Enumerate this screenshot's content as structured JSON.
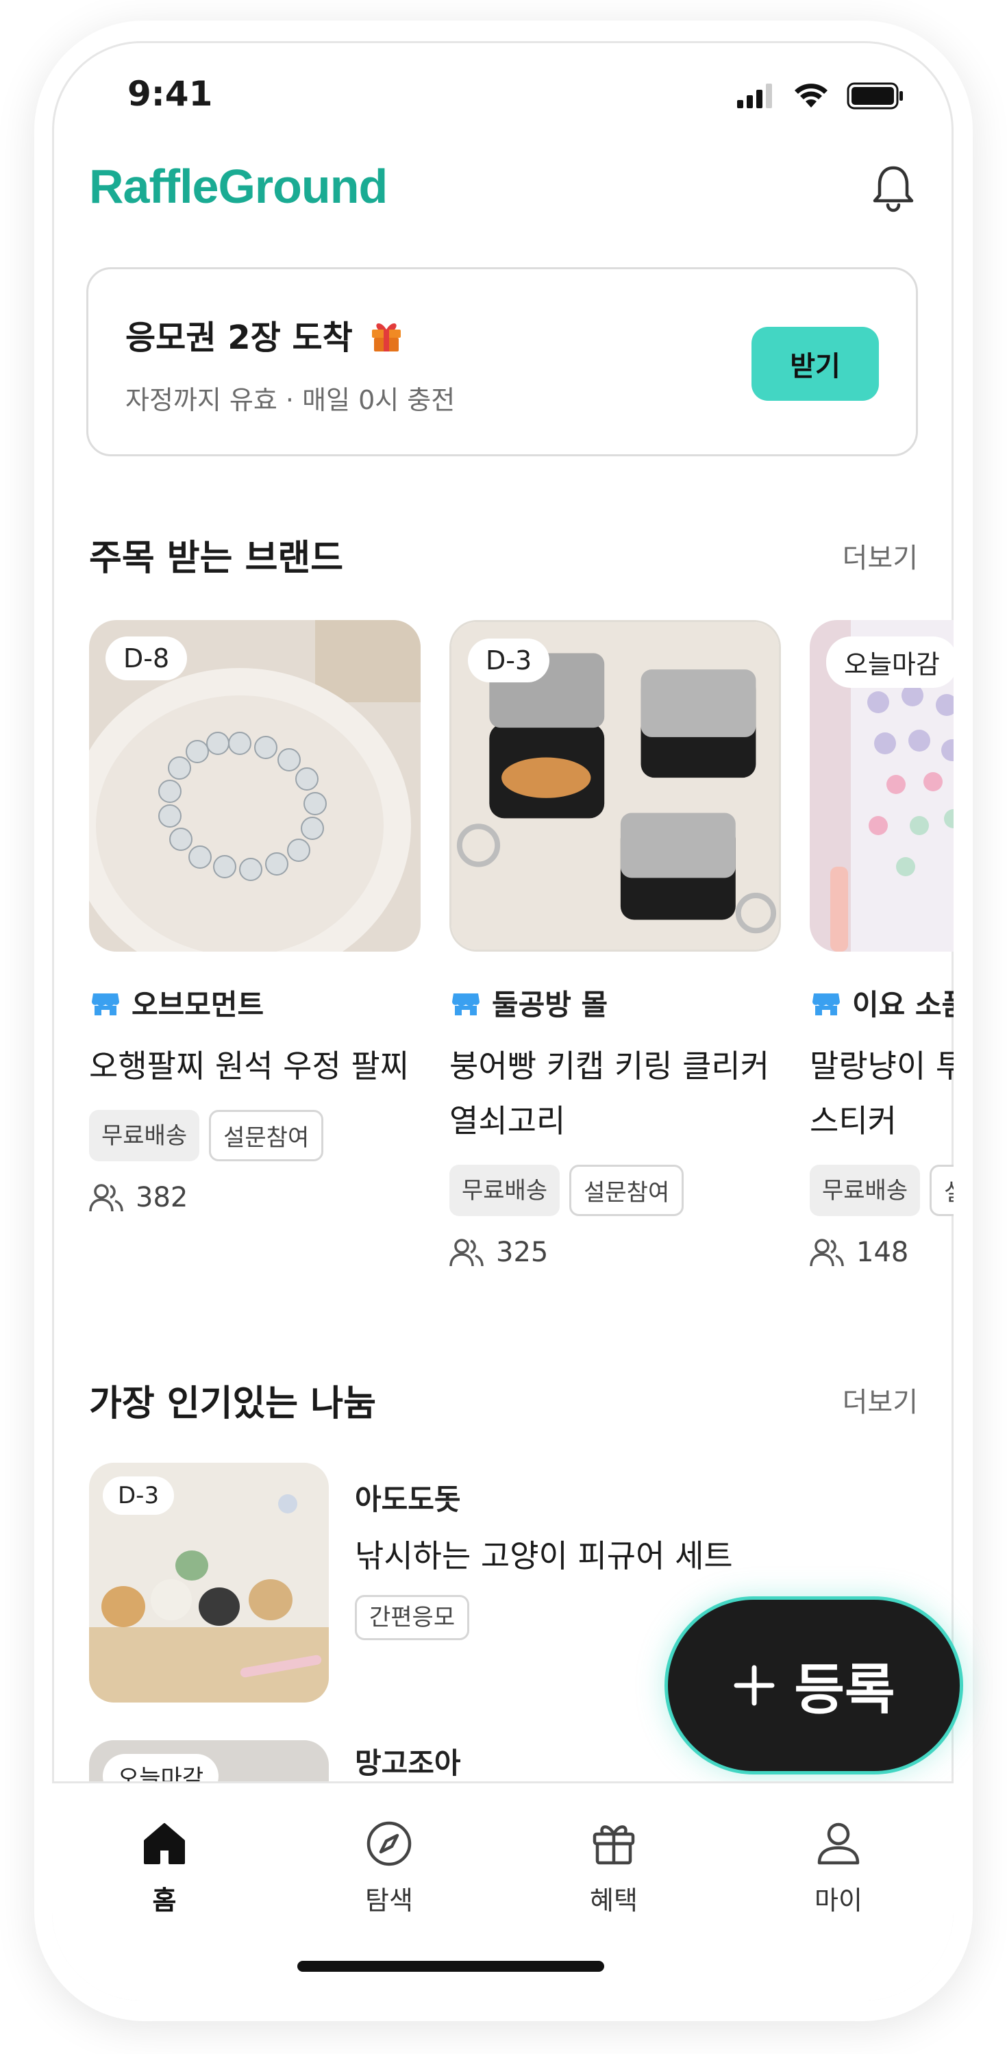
{
  "status_bar": {
    "time": "9:41"
  },
  "header": {
    "app_name": "RaffleGround"
  },
  "ticket_card": {
    "title": "응모권 2장 도착",
    "subtitle": "자정까지 유효 · 매일 0시 충전",
    "button_label": "받기"
  },
  "featured": {
    "title": "주목 받는 브랜드",
    "more_label": "더보기",
    "items": [
      {
        "badge": "D-8",
        "brand": "오브모먼트",
        "title": "오행팔찌 원석 우정 팔찌",
        "tags": [
          "무료배송",
          "설문참여"
        ],
        "participants": "382"
      },
      {
        "badge": "D-3",
        "brand": "둘공방 몰",
        "title": "붕어빵 키캡 키링 클리커 열쇠고리",
        "tags": [
          "무료배송",
          "설문참여"
        ],
        "participants": "325"
      },
      {
        "badge": "오늘마감",
        "brand": "이요 소품",
        "title": "말랑냥이 투명 폰꾸 다꾸 스티커",
        "tags": [
          "무료배송",
          "설문참여"
        ],
        "participants": "148"
      }
    ]
  },
  "popular": {
    "title": "가장 인기있는 나눔",
    "more_label": "더보기",
    "items": [
      {
        "badge": "D-3",
        "brand": "아도도돗",
        "title": "낚시하는 고양이 피규어 세트",
        "tag": "간편응모"
      },
      {
        "badge": "오늘마감",
        "brand": "망고조아"
      }
    ]
  },
  "fab": {
    "label": "등록"
  },
  "bottom_nav": {
    "items": [
      {
        "label": "홈",
        "icon": "home-icon",
        "active": true
      },
      {
        "label": "탐색",
        "icon": "compass-icon"
      },
      {
        "label": "혜택",
        "icon": "gift-icon"
      },
      {
        "label": "마이",
        "icon": "user-icon"
      }
    ]
  },
  "colors": {
    "accent": "#43d6c3",
    "logo": "#1aab93",
    "brand_icon": "#3aa0f0",
    "fab_bg": "#1c1c1c"
  }
}
